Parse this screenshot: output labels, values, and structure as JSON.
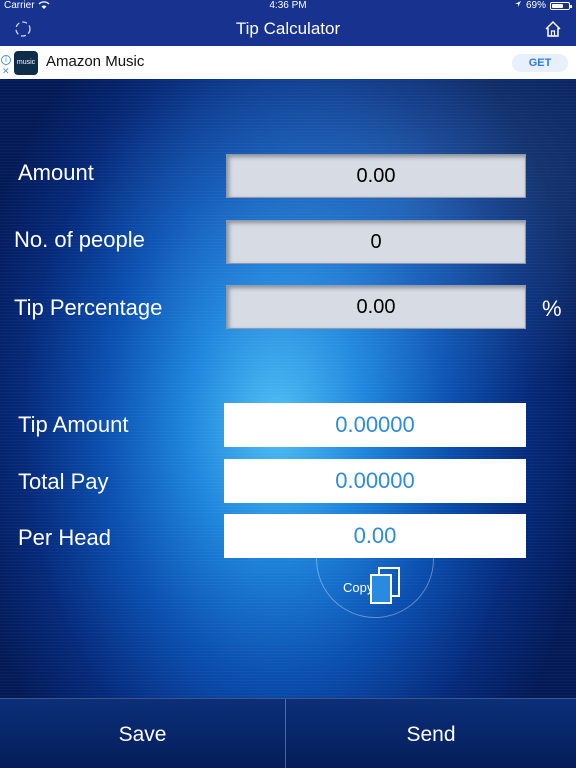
{
  "status_bar": {
    "carrier": "Carrier",
    "time": "4:36 PM",
    "battery": "69%",
    "battery_level": 0.69
  },
  "nav": {
    "title": "Tip Calculator"
  },
  "ad": {
    "logo_text": "music",
    "name": "Amazon Music",
    "cta": "GET"
  },
  "inputs": {
    "amount": {
      "label": "Amount",
      "value": "0.00"
    },
    "people": {
      "label": "No. of people",
      "value": "0"
    },
    "tip_percentage": {
      "label": "Tip Percentage",
      "value": "0.00",
      "unit": "%"
    }
  },
  "results": {
    "tip_amount": {
      "label": "Tip Amount",
      "value": "0.00000"
    },
    "total_pay": {
      "label": "Total Pay",
      "value": "0.00000"
    },
    "per_head": {
      "label": "Per Head",
      "value": "0.00"
    }
  },
  "copy": {
    "label": "Copy"
  },
  "bottom": {
    "save": "Save",
    "send": "Send"
  },
  "colors": {
    "nav_bg": "#17338f",
    "result_text": "#2e8cd8"
  }
}
